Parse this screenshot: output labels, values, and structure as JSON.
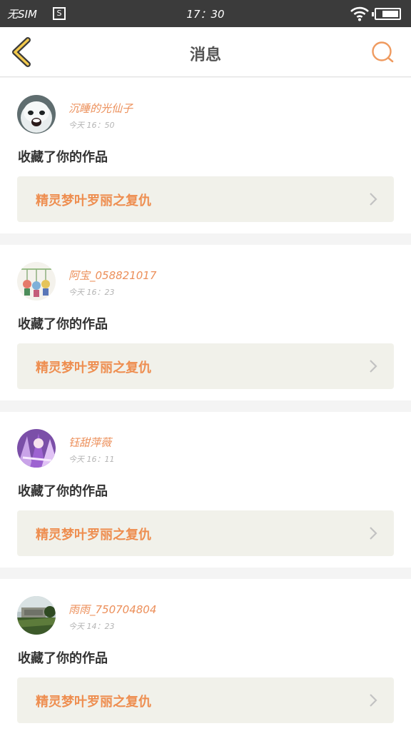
{
  "status_bar": {
    "carrier": "无SIM",
    "sim_icon": "S",
    "time": "17：30",
    "wifi_icon": "wifi-icon",
    "battery_icon": "battery-icon"
  },
  "header": {
    "title": "消息",
    "back_icon": "back-chevron-icon",
    "search_icon": "search-icon"
  },
  "colors": {
    "accent": "#ec8f5a",
    "work_bg": "#f1f1ea",
    "statusbar_bg": "#3b3b3b"
  },
  "notifications": [
    {
      "username": "沉睡的光仙子",
      "time": "今天 16：50",
      "action": "收藏了你的作品",
      "work_title": "精灵梦叶罗丽之复仇",
      "avatar": "avatar-white-creature"
    },
    {
      "username": "阿宝_058821017",
      "time": "今天 16：23",
      "action": "收藏了你的作品",
      "work_title": "精灵梦叶罗丽之复仇",
      "avatar": "avatar-dolls"
    },
    {
      "username": "钰甜萍薇",
      "time": "今天 16：11",
      "action": "收藏了你的作品",
      "work_title": "精灵梦叶罗丽之复仇",
      "avatar": "avatar-purple-anime"
    },
    {
      "username": "雨雨_750704804",
      "time": "今天 14：23",
      "action": "收藏了你的作品",
      "work_title": "精灵梦叶罗丽之复仇",
      "avatar": "avatar-landscape"
    }
  ]
}
